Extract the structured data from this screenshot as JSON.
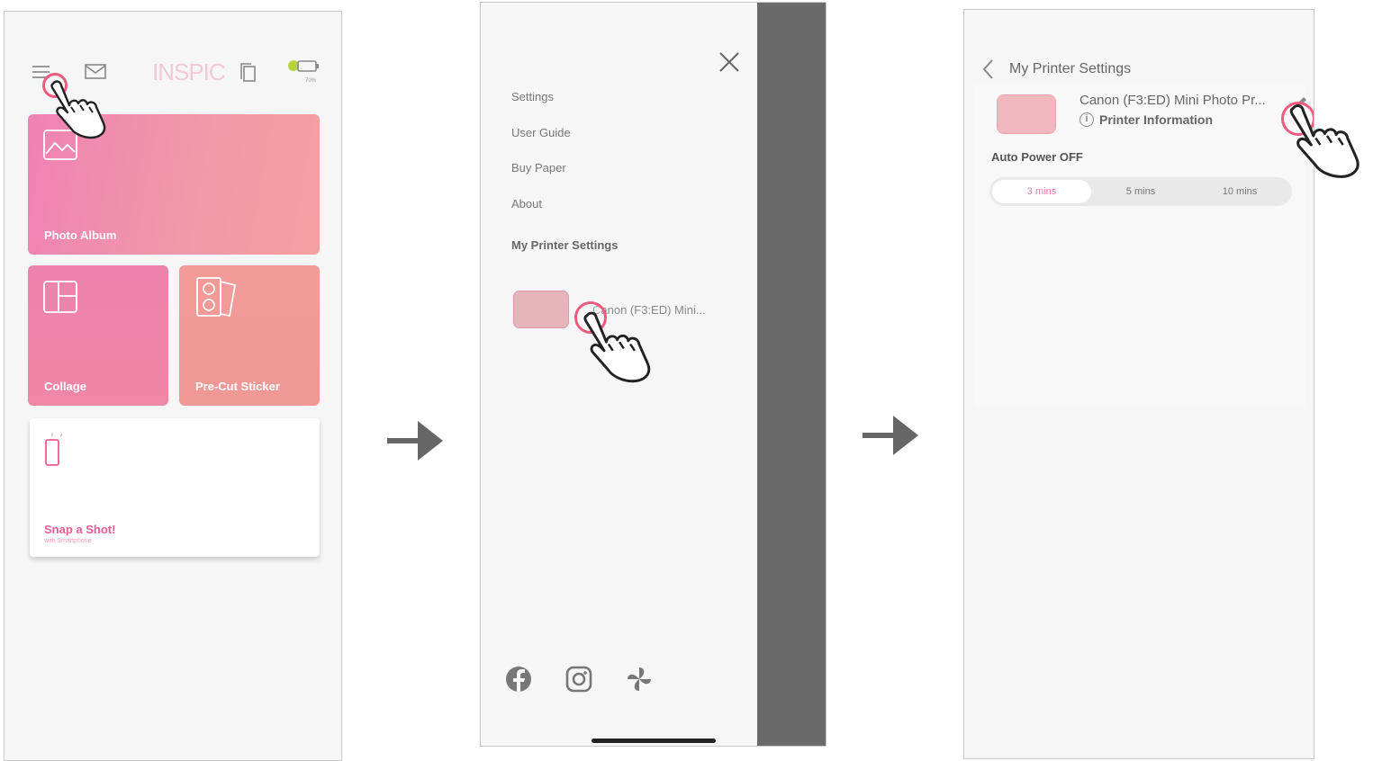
{
  "screen1": {
    "logo_text": "INSPIC",
    "battery_text": "70%",
    "tiles": {
      "photo_album": "Photo Album",
      "collage": "Collage",
      "pre_cut_sticker": "Pre-Cut Sticker",
      "snap_a_shot": "Snap a Shot!",
      "snap_subtitle": "with Smartphone"
    }
  },
  "screen2": {
    "menu": [
      "Settings",
      "User Guide",
      "Buy Paper",
      "About"
    ],
    "section_title": "My Printer Settings",
    "printer_name": "Canon (F3:ED) Mini..."
  },
  "screen3": {
    "title": "My Printer Settings",
    "printer_name": "Canon (F3:ED) Mini Photo Pr...",
    "printer_info": "Printer Information",
    "auto_power_label": "Auto Power OFF",
    "options": [
      "3 mins",
      "5 mins",
      "10 mins"
    ],
    "selected_option": "3 mins"
  },
  "colors": {
    "accent_pink": "#ec5b93",
    "tap_ring": "#f05a7e",
    "overlay": "#6a6a6a"
  }
}
